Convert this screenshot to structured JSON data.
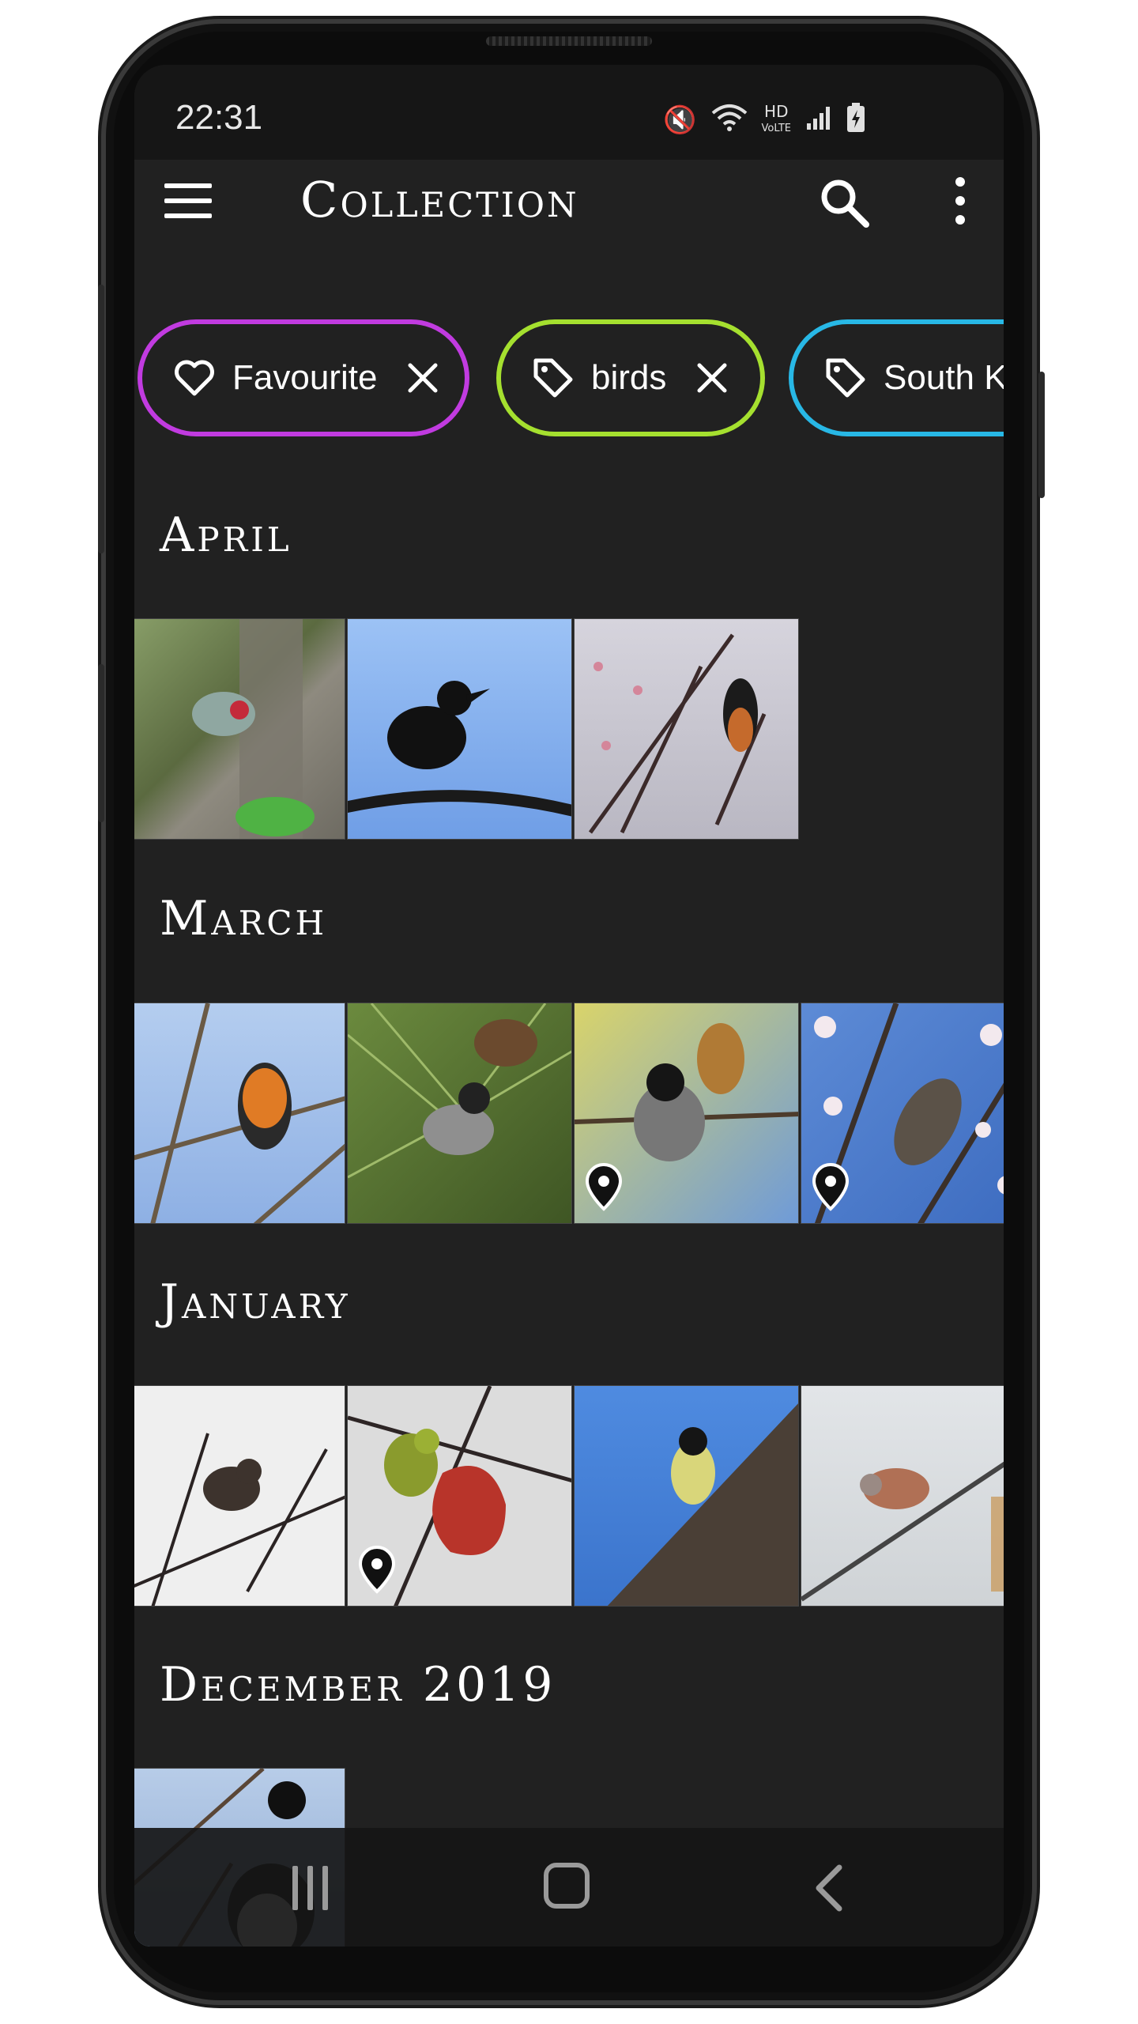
{
  "status_bar": {
    "time": "22:31",
    "icons": [
      "mute-icon",
      "wifi-icon",
      "hd-voice-icon",
      "signal-icon",
      "battery-icon"
    ]
  },
  "toolbar": {
    "title": "Collection",
    "menu_icon": "menu-icon",
    "search_icon": "search-icon",
    "more_icon": "more-vert-icon"
  },
  "chips": [
    {
      "label": "Favourite",
      "icon": "heart-icon",
      "color": "#c13be0"
    },
    {
      "label": "birds",
      "icon": "tag-icon",
      "color": "#a5e02f"
    },
    {
      "label": "South Ko",
      "icon": "tag-icon",
      "color": "#28b8e6"
    }
  ],
  "sections": [
    {
      "title": "April",
      "tiles": [
        {
          "bird": "woodpecker",
          "bg": "#6f7d55",
          "has_location": false
        },
        {
          "bird": "crow",
          "bg": "#8db4ee",
          "has_location": false
        },
        {
          "bird": "redstart",
          "bg": "#c8c5d0",
          "has_location": false
        }
      ]
    },
    {
      "title": "March",
      "tiles": [
        {
          "bird": "robin",
          "bg": "#9dbbe8",
          "has_location": false
        },
        {
          "bird": "tit-pine",
          "bg": "#5f7a3a",
          "has_location": false
        },
        {
          "bird": "tit-catkin",
          "bg": "#c7c250",
          "has_location": true
        },
        {
          "bird": "bulbul",
          "bg": "#6f95d6",
          "has_location": true
        }
      ]
    },
    {
      "title": "January",
      "tiles": [
        {
          "bird": "sparrow",
          "bg": "#eeeeee",
          "has_location": false
        },
        {
          "bird": "white-eye",
          "bg": "#d9d9d9",
          "has_location": true
        },
        {
          "bird": "great-tit",
          "bg": "#4c86d8",
          "has_location": false
        },
        {
          "bird": "dove",
          "bg": "#dcdfe2",
          "has_location": false
        }
      ]
    },
    {
      "title": "December 2019",
      "tiles": [
        {
          "bird": "magpie",
          "bg": "#a9c2e4",
          "has_location": false
        }
      ]
    }
  ],
  "nav_bar": {
    "recents_icon": "recents-icon",
    "home_icon": "home-icon",
    "back_icon": "back-icon"
  }
}
